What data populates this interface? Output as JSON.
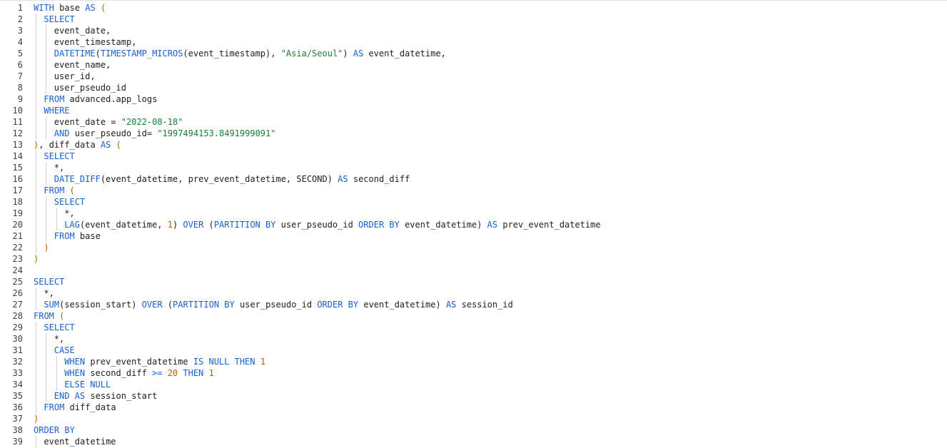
{
  "editor": {
    "language": "SQL",
    "colors": {
      "keyword": "#1a5fd0",
      "string": "#188038",
      "number": "#b06000",
      "identifier": "#202124",
      "line_number": "#3c4043",
      "indent_guide": "#d0d0d0"
    },
    "lines": [
      {
        "n": "1",
        "indent": 0,
        "tokens": [
          [
            "kw",
            "WITH"
          ],
          [
            "id",
            " base "
          ],
          [
            "kw",
            "AS"
          ],
          [
            "par",
            " ("
          ]
        ]
      },
      {
        "n": "2",
        "indent": 1,
        "tokens": [
          [
            "kw",
            "SELECT"
          ]
        ]
      },
      {
        "n": "3",
        "indent": 2,
        "tokens": [
          [
            "id",
            "event_date,"
          ]
        ]
      },
      {
        "n": "4",
        "indent": 2,
        "tokens": [
          [
            "id",
            "event_timestamp,"
          ]
        ]
      },
      {
        "n": "5",
        "indent": 2,
        "tokens": [
          [
            "kw",
            "DATETIME"
          ],
          [
            "id",
            "("
          ],
          [
            "kw",
            "TIMESTAMP_MICROS"
          ],
          [
            "id",
            "(event_timestamp), "
          ],
          [
            "str",
            "\"Asia/Seoul\""
          ],
          [
            "id",
            ") "
          ],
          [
            "kw",
            "AS"
          ],
          [
            "id",
            " event_datetime,"
          ]
        ]
      },
      {
        "n": "6",
        "indent": 2,
        "tokens": [
          [
            "id",
            "event_name,"
          ]
        ]
      },
      {
        "n": "7",
        "indent": 2,
        "tokens": [
          [
            "id",
            "user_id,"
          ]
        ]
      },
      {
        "n": "8",
        "indent": 2,
        "tokens": [
          [
            "id",
            "user_pseudo_id"
          ]
        ]
      },
      {
        "n": "9",
        "indent": 1,
        "tokens": [
          [
            "kw",
            "FROM"
          ],
          [
            "id",
            " advanced.app_logs"
          ]
        ]
      },
      {
        "n": "10",
        "indent": 1,
        "tokens": [
          [
            "kw",
            "WHERE"
          ]
        ]
      },
      {
        "n": "11",
        "indent": 2,
        "tokens": [
          [
            "id",
            "event_date = "
          ],
          [
            "str",
            "\"2022-08-18\""
          ]
        ]
      },
      {
        "n": "12",
        "indent": 2,
        "tokens": [
          [
            "kw",
            "AND"
          ],
          [
            "id",
            " user_pseudo_id= "
          ],
          [
            "str",
            "\"1997494153.8491999091\""
          ]
        ]
      },
      {
        "n": "13",
        "indent": 0,
        "tokens": [
          [
            "par",
            ")"
          ],
          [
            "id",
            ", diff_data "
          ],
          [
            "kw",
            "AS"
          ],
          [
            "par",
            " ("
          ]
        ]
      },
      {
        "n": "14",
        "indent": 1,
        "tokens": [
          [
            "kw",
            "SELECT"
          ]
        ]
      },
      {
        "n": "15",
        "indent": 2,
        "tokens": [
          [
            "id",
            "*,"
          ]
        ]
      },
      {
        "n": "16",
        "indent": 2,
        "tokens": [
          [
            "kw",
            "DATE_DIFF"
          ],
          [
            "id",
            "(event_datetime, prev_event_datetime, SECOND) "
          ],
          [
            "kw",
            "AS"
          ],
          [
            "id",
            " second_diff"
          ]
        ]
      },
      {
        "n": "17",
        "indent": 1,
        "tokens": [
          [
            "kw",
            "FROM"
          ],
          [
            "par",
            " ("
          ]
        ]
      },
      {
        "n": "18",
        "indent": 2,
        "tokens": [
          [
            "kw",
            "SELECT"
          ]
        ]
      },
      {
        "n": "19",
        "indent": 3,
        "tokens": [
          [
            "id",
            "*,"
          ]
        ]
      },
      {
        "n": "20",
        "indent": 3,
        "tokens": [
          [
            "kw",
            "LAG"
          ],
          [
            "id",
            "(event_datetime, "
          ],
          [
            "num",
            "1"
          ],
          [
            "id",
            ") "
          ],
          [
            "kw",
            "OVER"
          ],
          [
            "id",
            " ("
          ],
          [
            "kw",
            "PARTITION BY"
          ],
          [
            "id",
            " user_pseudo_id "
          ],
          [
            "kw",
            "ORDER BY"
          ],
          [
            "id",
            " event_datetime) "
          ],
          [
            "kw",
            "AS"
          ],
          [
            "id",
            " prev_event_datetime"
          ]
        ]
      },
      {
        "n": "21",
        "indent": 2,
        "tokens": [
          [
            "kw",
            "FROM"
          ],
          [
            "id",
            " base"
          ]
        ]
      },
      {
        "n": "22",
        "indent": 1,
        "tokens": [
          [
            "par",
            ")"
          ]
        ]
      },
      {
        "n": "23",
        "indent": 0,
        "tokens": [
          [
            "par",
            ")"
          ]
        ]
      },
      {
        "n": "24",
        "indent": 0,
        "tokens": []
      },
      {
        "n": "25",
        "indent": 0,
        "tokens": [
          [
            "kw",
            "SELECT"
          ]
        ]
      },
      {
        "n": "26",
        "indent": 1,
        "tokens": [
          [
            "id",
            "*,"
          ]
        ]
      },
      {
        "n": "27",
        "indent": 1,
        "tokens": [
          [
            "kw",
            "SUM"
          ],
          [
            "id",
            "(session_start) "
          ],
          [
            "kw",
            "OVER"
          ],
          [
            "id",
            " ("
          ],
          [
            "kw",
            "PARTITION BY"
          ],
          [
            "id",
            " user_pseudo_id "
          ],
          [
            "kw",
            "ORDER BY"
          ],
          [
            "id",
            " event_datetime) "
          ],
          [
            "kw",
            "AS"
          ],
          [
            "id",
            " session_id"
          ]
        ]
      },
      {
        "n": "28",
        "indent": 0,
        "tokens": [
          [
            "kw",
            "FROM"
          ],
          [
            "par",
            " ("
          ]
        ]
      },
      {
        "n": "29",
        "indent": 1,
        "tokens": [
          [
            "kw",
            "SELECT"
          ]
        ]
      },
      {
        "n": "30",
        "indent": 2,
        "tokens": [
          [
            "id",
            "*,"
          ]
        ]
      },
      {
        "n": "31",
        "indent": 2,
        "tokens": [
          [
            "kw",
            "CASE"
          ]
        ]
      },
      {
        "n": "32",
        "indent": 3,
        "tokens": [
          [
            "kw",
            "WHEN"
          ],
          [
            "id",
            " prev_event_datetime "
          ],
          [
            "kw",
            "IS NULL THEN"
          ],
          [
            "num",
            " 1"
          ]
        ]
      },
      {
        "n": "33",
        "indent": 3,
        "tokens": [
          [
            "kw",
            "WHEN"
          ],
          [
            "id",
            " second_diff "
          ],
          [
            "kw",
            ">="
          ],
          [
            "num",
            " 20"
          ],
          [
            "kw",
            " THEN"
          ],
          [
            "num",
            " 1"
          ]
        ]
      },
      {
        "n": "34",
        "indent": 3,
        "tokens": [
          [
            "kw",
            "ELSE NULL"
          ]
        ]
      },
      {
        "n": "35",
        "indent": 2,
        "tokens": [
          [
            "kw",
            "END AS"
          ],
          [
            "id",
            " session_start"
          ]
        ]
      },
      {
        "n": "36",
        "indent": 1,
        "tokens": [
          [
            "kw",
            "FROM"
          ],
          [
            "id",
            " diff_data"
          ]
        ]
      },
      {
        "n": "37",
        "indent": 0,
        "tokens": [
          [
            "par",
            ")"
          ]
        ]
      },
      {
        "n": "38",
        "indent": 0,
        "tokens": [
          [
            "kw",
            "ORDER BY"
          ]
        ]
      },
      {
        "n": "39",
        "indent": 1,
        "tokens": [
          [
            "id",
            "event_datetime"
          ]
        ]
      }
    ]
  }
}
